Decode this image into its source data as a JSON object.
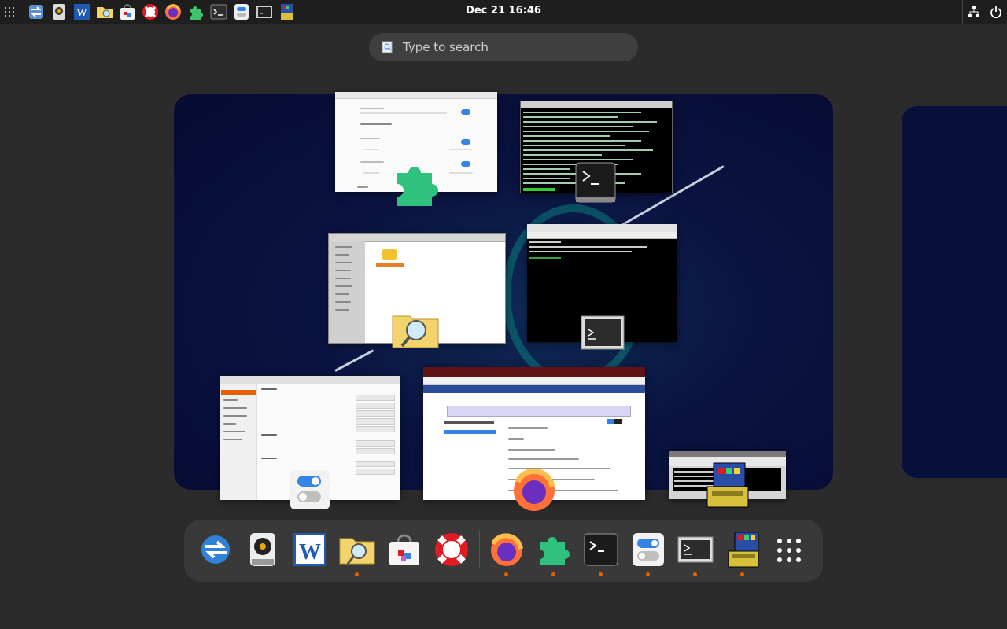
{
  "topbar": {
    "clock": "Dec 21  16:46",
    "pinned_icons": [
      "network-apps-icon",
      "rhythmbox-icon",
      "word-icon",
      "file-manager-icon",
      "software-icon",
      "help-icon",
      "firefox-icon",
      "extensions-icon",
      "terminal-icon",
      "tweaks-icon",
      "console-icon",
      "installer-icon"
    ]
  },
  "search": {
    "placeholder": "Type to search"
  },
  "windows": {
    "extensions": "Extensions",
    "terminal_log": "Terminal",
    "file_manager": "File Manager",
    "xterm": "Terminal",
    "tweaks": "Tweaks",
    "firefox": "Firefox",
    "installer_title": "Upgrade Wizard"
  },
  "dock": {
    "items": [
      "network-apps-icon",
      "rhythmbox-icon",
      "word-icon",
      "file-manager-icon",
      "software-icon",
      "help-icon",
      "firefox-icon",
      "extensions-icon",
      "terminal-icon",
      "tweaks-icon",
      "console-icon",
      "installer-icon"
    ]
  },
  "colors": {
    "accent": "#3584e4",
    "running_dot": "#e66100",
    "workspace_bg": "#0a1340"
  }
}
